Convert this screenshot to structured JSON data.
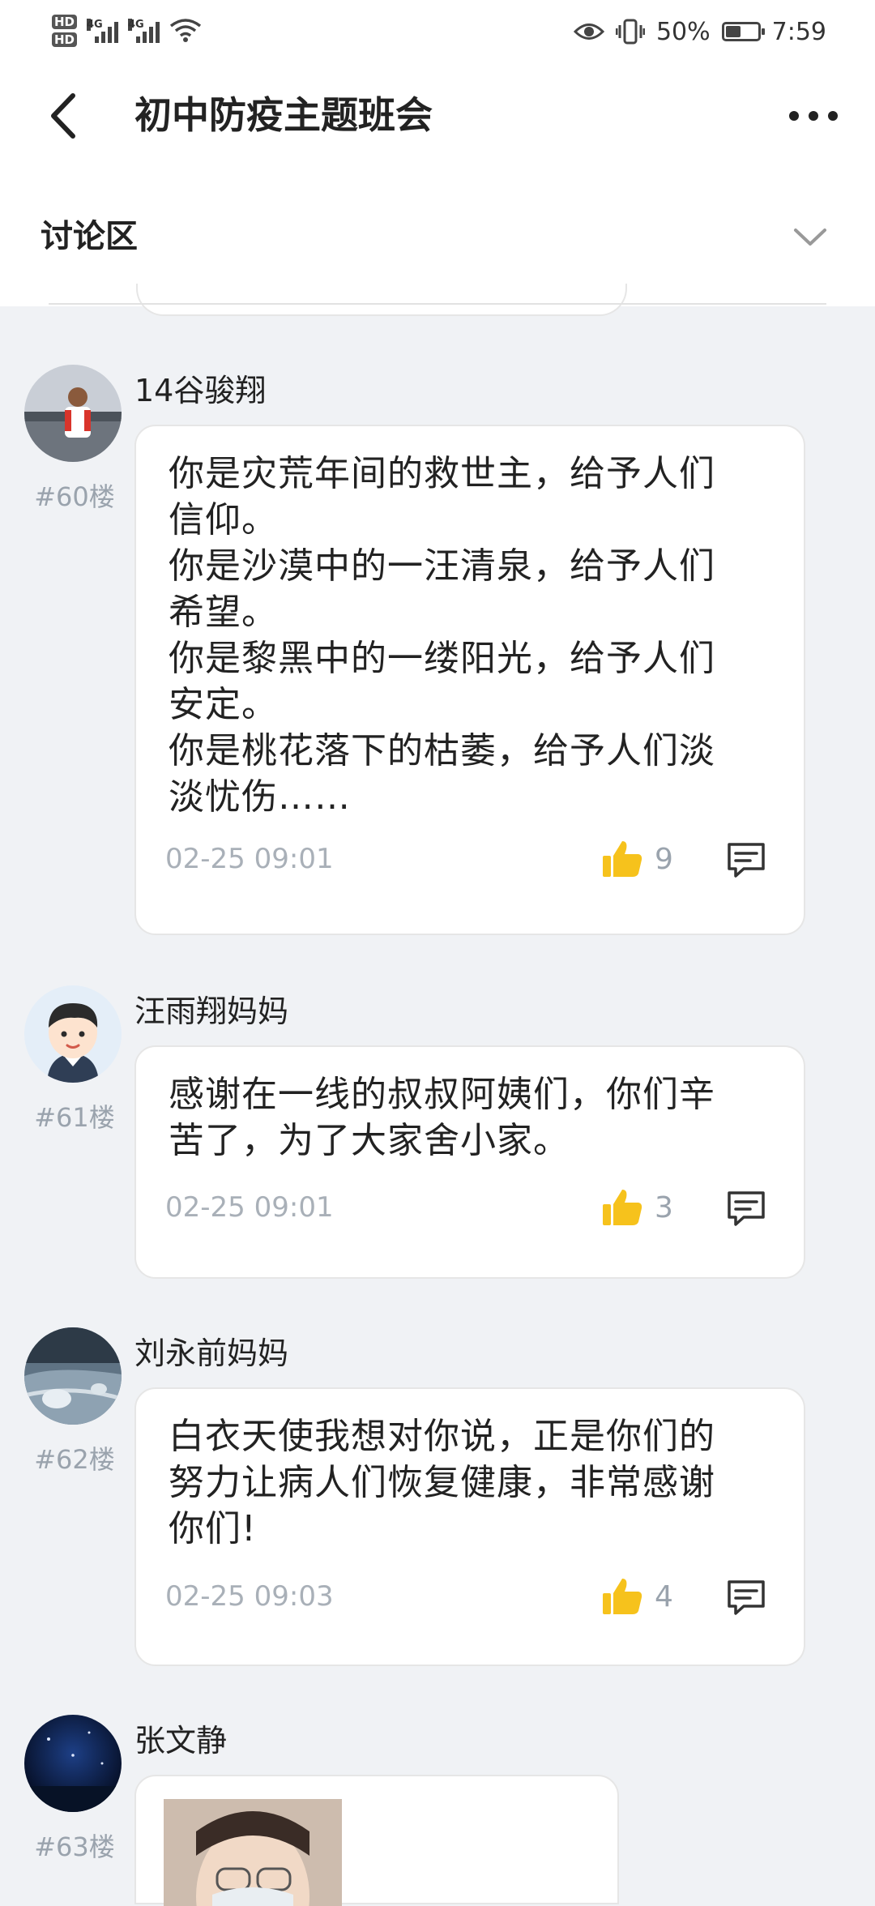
{
  "status_bar": {
    "hd1": "HD",
    "hd2": "HD",
    "net1": "4G",
    "net2": "4G",
    "battery_percent": "50%",
    "time": "7:59",
    "battery_level": 0.5
  },
  "nav": {
    "title": "初中防疫主题班会"
  },
  "section": {
    "title": "讨论区"
  },
  "posts": [
    {
      "author": "14谷骏翔",
      "floor": "#60楼",
      "content": "你是灾荒年间的救世主，给予人们\n信仰。\n你是沙漠中的一汪清泉，给予人们\n希望。\n你是黎黑中的一缕阳光，给予人们\n安定。\n你是桃花落下的枯萎，给予人们淡\n淡忧伤……",
      "time": "02-25 09:01",
      "likes": "9"
    },
    {
      "author": "汪雨翔妈妈",
      "floor": "#61楼",
      "content": "感谢在一线的叔叔阿姨们，你们辛\n苦了，为了大家舍小家。",
      "time": "02-25 09:01",
      "likes": "3"
    },
    {
      "author": "刘永前妈妈",
      "floor": "#62楼",
      "content": "白衣天使我想对你说，正是你们的\n努力让病人们恢复健康，非常感谢\n你们!",
      "time": "02-25 09:03",
      "likes": "4"
    },
    {
      "author": "张文静",
      "floor": "#63楼"
    }
  ],
  "colors": {
    "like_yellow": "#f6c21c",
    "background": "#f0f2f5"
  }
}
